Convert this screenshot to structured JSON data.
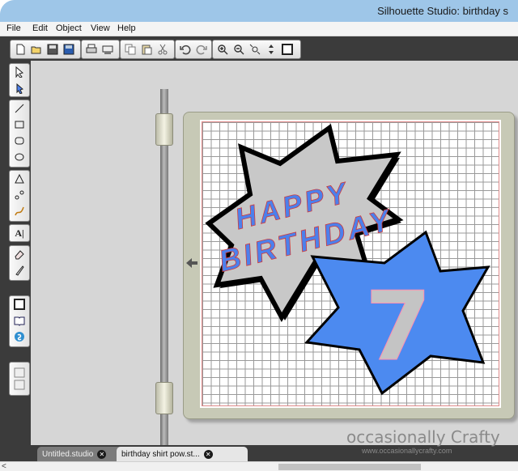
{
  "window": {
    "title": "Silhouette Studio: birthday s"
  },
  "menu": [
    "File",
    "Edit",
    "Object",
    "View",
    "Help"
  ],
  "toolbar": {
    "groups": [
      [
        "new-document-icon",
        "open-icon",
        "save-icon",
        "save-library-icon"
      ],
      [
        "print-icon",
        "cut-send-icon"
      ],
      [
        "copy-icon",
        "paste-icon",
        "scissors-icon"
      ],
      [
        "undo-icon",
        "redo-icon"
      ],
      [
        "zoom-in-icon",
        "zoom-out-icon",
        "zoom-select-icon",
        "pan-icon",
        "fit-page-icon"
      ]
    ]
  },
  "tools": {
    "groups": [
      [
        "select-icon",
        "point-edit-icon"
      ],
      [
        "line-icon",
        "rectangle-icon",
        "rounded-rectangle-icon",
        "ellipse-icon"
      ],
      [
        "polygon-icon",
        "curve-icon",
        "freehand-icon"
      ],
      [
        "text-icon"
      ],
      [
        "eraser-icon",
        "knife-icon"
      ],
      [
        "page-setup-icon",
        "library-icon",
        "store-icon"
      ],
      [
        "split-view-icon"
      ]
    ]
  },
  "artwork": {
    "text_line1": "HAPPY",
    "text_line2": "BIRTHDAY",
    "number": "7",
    "colors": {
      "burst_fill": "#c8c8c8",
      "burst_outline": "#000000",
      "text": "#4c80ec",
      "star_fill": "#4c8af0",
      "number_fill": "#c4c4c4"
    }
  },
  "tabs": [
    {
      "label": "Untitled.studio",
      "active": false
    },
    {
      "label": "birthday shirt pow.st...",
      "active": true
    }
  ],
  "watermark": {
    "name": "occasionally Crafty",
    "url": "www.occasionallycrafty.com"
  },
  "scrollbar": {
    "left_arrow": "<"
  }
}
